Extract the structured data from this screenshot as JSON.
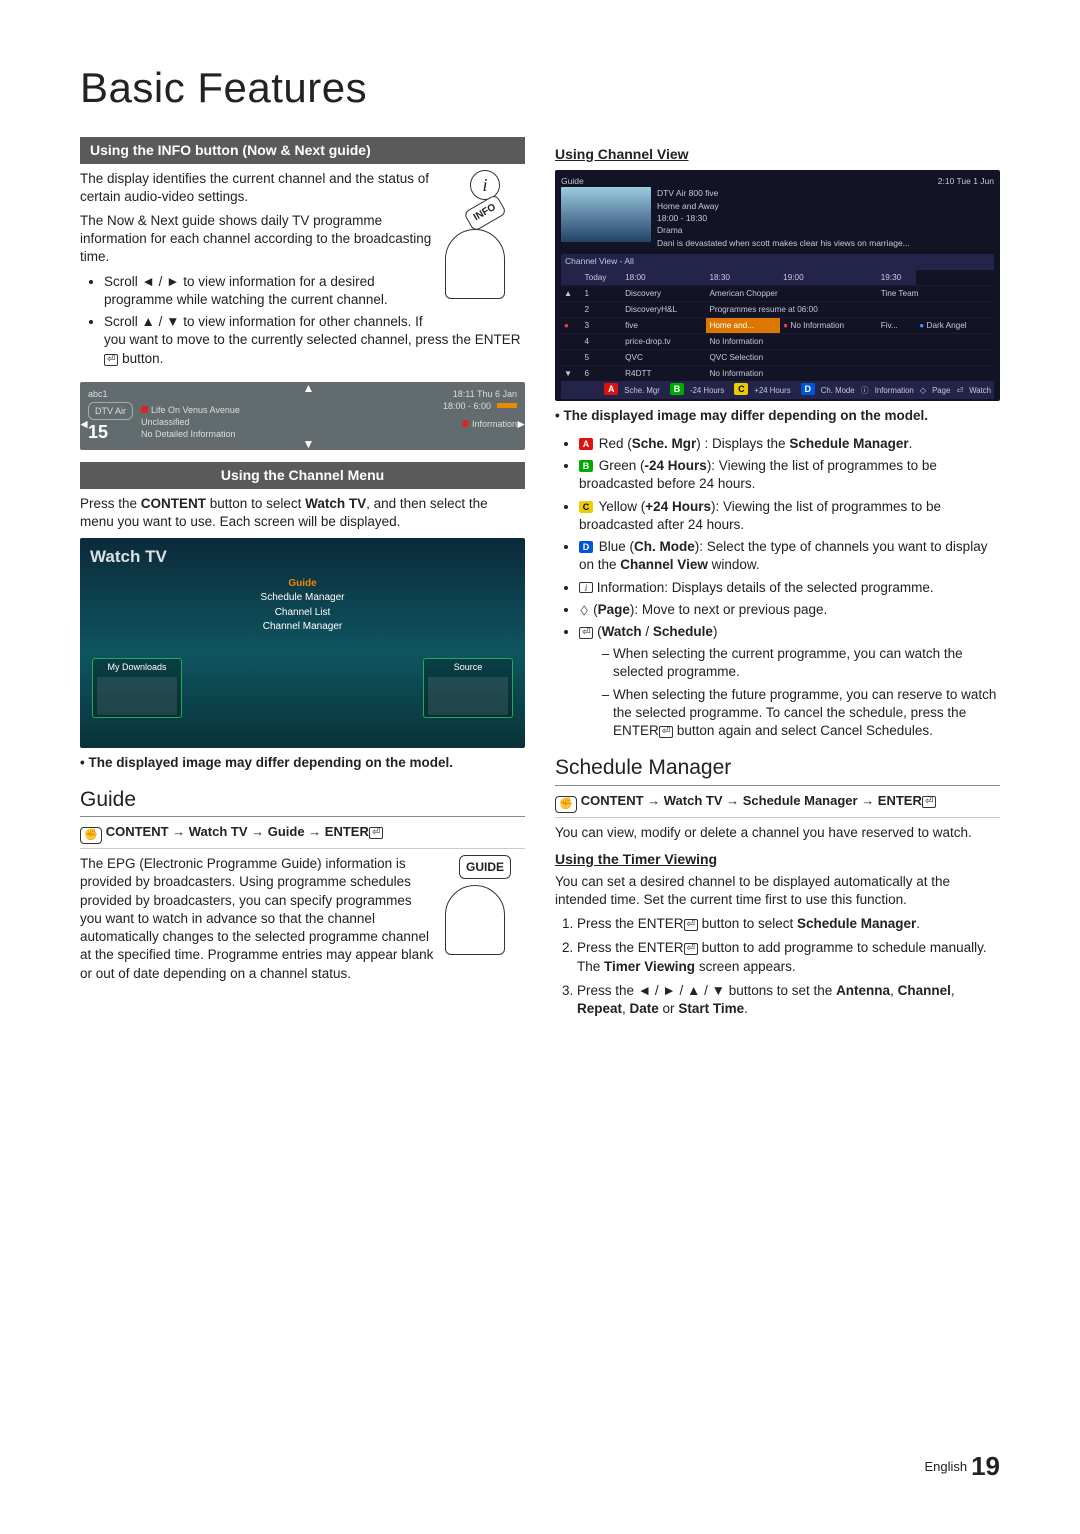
{
  "page_title": "Basic Features",
  "footer": {
    "lang": "English",
    "num": "19"
  },
  "left": {
    "sec1_bar": "Using the INFO button (Now & Next guide)",
    "sec1_p1": "The display identifies the current channel and the status of certain audio-video settings.",
    "sec1_p2": "The Now & Next guide shows daily TV programme information for each channel according to the broadcasting time.",
    "sec1_li1a": "Scroll ",
    "sec1_li1b": " to view information for a desired programme while watching the current channel.",
    "sec1_li2a": "Scroll ",
    "sec1_li2b": " to view information for other channels. If you want to move to the currently selected channel, press the ENTER",
    "sec1_li2c": " button.",
    "info_btn": "INFO",
    "info_box": {
      "ch": "abc1",
      "left_chip": "DTV Air",
      "num": "15",
      "prog": "Life On Venus Avenue",
      "cls": "Unclassified",
      "det": "No Detailed Information",
      "time": "18:11 Thu 6 Jan",
      "range": "18:00 - 6:00",
      "info": "Information"
    },
    "sec2_bar": "Using the Channel Menu",
    "sec2_p": "Press the CONTENT button to select Watch TV, and then select the menu you want to use. Each screen will be displayed.",
    "watch": {
      "title": "Watch TV",
      "items": [
        "Guide",
        "Schedule Manager",
        "Channel List",
        "Channel Manager"
      ],
      "panel1": "My Downloads",
      "panel2": "Source"
    },
    "note": "The displayed image may differ depending on the model.",
    "guide_h": "Guide",
    "guide_nav": "CONTENT → Watch TV → Guide → ENTER",
    "guide_btn": "GUIDE",
    "guide_p": "The EPG (Electronic Programme Guide) information is provided by broadcasters. Using programme schedules provided by broadcasters, you can specify programmes you want to watch in advance so that the channel automatically changes to the selected programme channel at the specified time. Programme entries may appear blank or out of date depending on a channel status."
  },
  "right": {
    "cv_h": "Using Channel View",
    "gb": {
      "title": "Guide",
      "clock": "2:10 Tue 1 Jun",
      "meta1": "DTV Air 800 five",
      "meta2": "Home and Away",
      "meta3": "18:00 - 18:30",
      "meta4": "Drama",
      "meta5": "Dani is devastated when scott makes clear his views on marriage...",
      "hdr": "Channel View - All",
      "cols": [
        "Today",
        "18:00",
        "18:30",
        "19:00",
        "19:30"
      ],
      "rows": [
        {
          "n": "1",
          "ch": "Discovery",
          "c1": "American Chopper",
          "c2": "",
          "c3": "Tine Team",
          "c4": ""
        },
        {
          "n": "2",
          "ch": "DiscoveryH&L",
          "c1": "Programmes resume at 06:00",
          "c2": "",
          "c3": "",
          "c4": ""
        },
        {
          "n": "3",
          "ch": "five",
          "c1": "Home and...",
          "c2": "No Information",
          "c3": "Fiv...",
          "c4": "Dark Angel",
          "sel": true,
          "rec": true
        },
        {
          "n": "4",
          "ch": "price-drop.tv",
          "c1": "No Information",
          "c2": "",
          "c3": "",
          "c4": ""
        },
        {
          "n": "5",
          "ch": "QVC",
          "c1": "QVC Selection",
          "c2": "",
          "c3": "",
          "c4": ""
        },
        {
          "n": "6",
          "ch": "R4DTT",
          "c1": "No Information",
          "c2": "",
          "c3": "",
          "c4": ""
        }
      ],
      "legend": [
        "Sche. Mgr",
        "-24 Hours",
        "+24 Hours",
        "Ch. Mode",
        "Information",
        "Page",
        "Watch"
      ]
    },
    "note": "The displayed image may differ depending on the model.",
    "li_a": " Red (Sche. Mgr) : Displays the Schedule Manager.",
    "li_b": " Green (-24 Hours): Viewing the list of programmes to be broadcasted before 24 hours.",
    "li_c": " Yellow (+24 Hours): Viewing the list of programmes to be broadcasted after 24 hours.",
    "li_d": " Blue (Ch. Mode): Select the type of channels you want to display on the Channel View window.",
    "li_info": " Information: Displays details of the selected programme.",
    "li_page": " (Page): Move to next or previous page.",
    "li_ws": " (Watch / Schedule)",
    "li_ws1": "When selecting the current programme, you can watch the selected programme.",
    "li_ws2a": "When selecting the future programme, you can reserve to watch the selected programme. To cancel the schedule, press the ENTER",
    "li_ws2b": " button again and select Cancel Schedules.",
    "sm_h": "Schedule Manager",
    "sm_nav": "CONTENT → Watch TV → Schedule Manager → ENTER",
    "sm_p": "You can view, modify or delete a channel you have reserved to watch.",
    "tv_h": "Using the Timer Viewing",
    "tv_p": "You can set a desired channel to be displayed automatically at the intended time. Set the current time first to use this function.",
    "ol1a": "Press the ENTER",
    "ol1b": " button to select Schedule Manager.",
    "ol2a": "Press the ENTER",
    "ol2b": " button to add programme to schedule manually. The Timer Viewing screen appears.",
    "ol3a": "Press the ",
    "ol3b": " buttons to set the Antenna, Channel, Repeat, Date or Start Time."
  }
}
